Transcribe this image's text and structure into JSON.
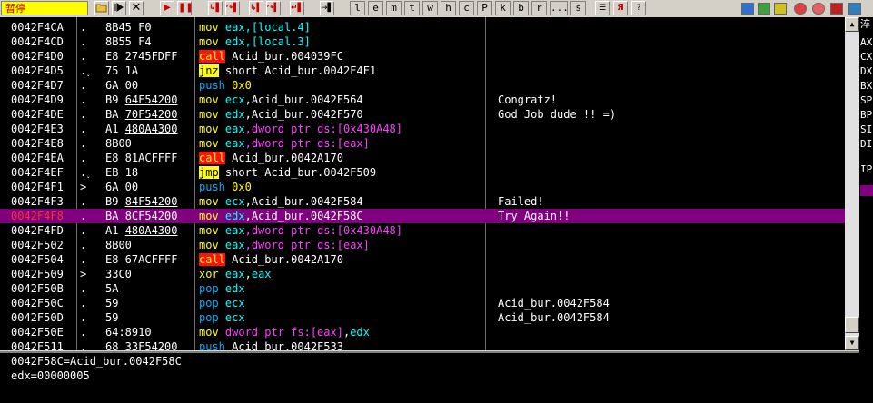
{
  "toolbar": {
    "status": "暂停",
    "letters": [
      "l",
      "e",
      "m",
      "t",
      "w",
      "h",
      "c",
      "P",
      "k",
      "b",
      "r",
      "...",
      "s"
    ]
  },
  "rows": [
    {
      "addr": "0042F4CA",
      "mark": ".",
      "hex": "8B45 F0",
      "hex_u": "",
      "dis": [
        {
          "t": "mov",
          "c": "mn-mov"
        },
        {
          "t": " "
        },
        {
          "t": "eax",
          "c": "reg"
        },
        {
          "t": ",[local.4]",
          "c": "reg"
        }
      ],
      "comment": ""
    },
    {
      "addr": "0042F4CD",
      "mark": ".",
      "hex": "8B55 F4",
      "hex_u": "",
      "dis": [
        {
          "t": "mov",
          "c": "mn-mov"
        },
        {
          "t": " "
        },
        {
          "t": "edx",
          "c": "reg"
        },
        {
          "t": ",[local.3]",
          "c": "reg"
        }
      ],
      "comment": ""
    },
    {
      "addr": "0042F4D0",
      "mark": ".",
      "hex": "E8 2745FDFF",
      "hex_u": "",
      "dis": [
        {
          "t": "call",
          "c": "mn-call"
        },
        {
          "t": " Acid_bur.004039FC",
          "c": "plain"
        }
      ],
      "comment": ""
    },
    {
      "addr": "0042F4D5",
      "mark": ".˯",
      "hex": "75 1A",
      "hex_u": "",
      "dis": [
        {
          "t": "jnz",
          "c": "mn-jmp"
        },
        {
          "t": " short Acid_bur.0042F4F1",
          "c": "plain"
        }
      ],
      "comment": ""
    },
    {
      "addr": "0042F4D7",
      "mark": ".",
      "hex": "6A 00",
      "hex_u": "",
      "dis": [
        {
          "t": "push",
          "c": "mn-push"
        },
        {
          "t": " 0x0",
          "c": "hexnum"
        }
      ],
      "comment": ""
    },
    {
      "addr": "0042F4D9",
      "mark": ".",
      "hex": "B9 ",
      "hex_u": "64F54200",
      "dis": [
        {
          "t": "mov",
          "c": "mn-mov"
        },
        {
          "t": " "
        },
        {
          "t": "ecx",
          "c": "reg"
        },
        {
          "t": ",Acid_bur.0042F564",
          "c": "plain"
        }
      ],
      "comment": "Congratz!"
    },
    {
      "addr": "0042F4DE",
      "mark": ".",
      "hex": "BA ",
      "hex_u": "70F54200",
      "dis": [
        {
          "t": "mov",
          "c": "mn-mov"
        },
        {
          "t": " "
        },
        {
          "t": "edx",
          "c": "reg"
        },
        {
          "t": ",Acid_bur.0042F570",
          "c": "plain"
        }
      ],
      "comment": "God Job dude !! =)"
    },
    {
      "addr": "0042F4E3",
      "mark": ".",
      "hex": "A1 ",
      "hex_u": "480A4300",
      "dis": [
        {
          "t": "mov",
          "c": "mn-mov"
        },
        {
          "t": " "
        },
        {
          "t": "eax",
          "c": "reg"
        },
        {
          "t": ",dword ptr ds:[0x430A48]",
          "c": "mem"
        }
      ],
      "comment": ""
    },
    {
      "addr": "0042F4E8",
      "mark": ".",
      "hex": "8B00",
      "hex_u": "",
      "dis": [
        {
          "t": "mov",
          "c": "mn-mov"
        },
        {
          "t": " "
        },
        {
          "t": "eax",
          "c": "reg"
        },
        {
          "t": ",dword ptr ds:[eax]",
          "c": "mem"
        }
      ],
      "comment": ""
    },
    {
      "addr": "0042F4EA",
      "mark": ".",
      "hex": "E8 81ACFFFF",
      "hex_u": "",
      "dis": [
        {
          "t": "call",
          "c": "mn-call"
        },
        {
          "t": " Acid_bur.0042A170",
          "c": "plain"
        }
      ],
      "comment": ""
    },
    {
      "addr": "0042F4EF",
      "mark": ".˯",
      "hex": "EB 18",
      "hex_u": "",
      "dis": [
        {
          "t": "jmp",
          "c": "mn-jmp"
        },
        {
          "t": " short Acid_bur.0042F509",
          "c": "plain"
        }
      ],
      "comment": ""
    },
    {
      "addr": "0042F4F1",
      "mark": ">",
      "hex": "6A 00",
      "hex_u": "",
      "dis": [
        {
          "t": "push",
          "c": "mn-push"
        },
        {
          "t": " 0x0",
          "c": "hexnum"
        }
      ],
      "comment": ""
    },
    {
      "addr": "0042F4F3",
      "mark": ".",
      "hex": "B9 ",
      "hex_u": "84F54200",
      "dis": [
        {
          "t": "mov",
          "c": "mn-mov"
        },
        {
          "t": " "
        },
        {
          "t": "ecx",
          "c": "reg"
        },
        {
          "t": ",Acid_bur.0042F584",
          "c": "plain"
        }
      ],
      "comment": "Failed!"
    },
    {
      "addr": "0042F4F8",
      "mark": ".",
      "hex": "BA ",
      "hex_u": "8CF54200",
      "dis": [
        {
          "t": "mov",
          "c": "mn-mov"
        },
        {
          "t": " "
        },
        {
          "t": "edx",
          "c": "reg"
        },
        {
          "t": ",Acid_bur.0042F58C",
          "c": "plain"
        }
      ],
      "comment": "Try Again!!",
      "selected": true
    },
    {
      "addr": "0042F4FD",
      "mark": ".",
      "hex": "A1 ",
      "hex_u": "480A4300",
      "dis": [
        {
          "t": "mov",
          "c": "mn-mov"
        },
        {
          "t": " "
        },
        {
          "t": "eax",
          "c": "reg"
        },
        {
          "t": ",dword ptr ds:[0x430A48]",
          "c": "mem"
        }
      ],
      "comment": ""
    },
    {
      "addr": "0042F502",
      "mark": ".",
      "hex": "8B00",
      "hex_u": "",
      "dis": [
        {
          "t": "mov",
          "c": "mn-mov"
        },
        {
          "t": " "
        },
        {
          "t": "eax",
          "c": "reg"
        },
        {
          "t": ",dword ptr ds:[eax]",
          "c": "mem"
        }
      ],
      "comment": ""
    },
    {
      "addr": "0042F504",
      "mark": ".",
      "hex": "E8 67ACFFFF",
      "hex_u": "",
      "dis": [
        {
          "t": "call",
          "c": "mn-call"
        },
        {
          "t": " Acid_bur.0042A170",
          "c": "plain"
        }
      ],
      "comment": ""
    },
    {
      "addr": "0042F509",
      "mark": ">",
      "hex": "33C0",
      "hex_u": "",
      "dis": [
        {
          "t": "xor",
          "c": "mn-xor"
        },
        {
          "t": " "
        },
        {
          "t": "eax",
          "c": "reg"
        },
        {
          "t": ",",
          "c": "plain"
        },
        {
          "t": "eax",
          "c": "reg"
        }
      ],
      "comment": ""
    },
    {
      "addr": "0042F50B",
      "mark": ".",
      "hex": "5A",
      "hex_u": "",
      "dis": [
        {
          "t": "pop",
          "c": "mn-push"
        },
        {
          "t": " "
        },
        {
          "t": "edx",
          "c": "reg"
        }
      ],
      "comment": ""
    },
    {
      "addr": "0042F50C",
      "mark": ".",
      "hex": "59",
      "hex_u": "",
      "dis": [
        {
          "t": "pop",
          "c": "mn-push"
        },
        {
          "t": " "
        },
        {
          "t": "ecx",
          "c": "reg"
        }
      ],
      "comment": "Acid_bur.0042F584"
    },
    {
      "addr": "0042F50D",
      "mark": ".",
      "hex": "59",
      "hex_u": "",
      "dis": [
        {
          "t": "pop",
          "c": "mn-push"
        },
        {
          "t": " "
        },
        {
          "t": "ecx",
          "c": "reg"
        }
      ],
      "comment": "Acid_bur.0042F584"
    },
    {
      "addr": "0042F50E",
      "mark": ".",
      "hex": "64:8910",
      "hex_u": "",
      "dis": [
        {
          "t": "mov",
          "c": "mn-mov"
        },
        {
          "t": " dword ptr fs:[eax]",
          "c": "mem"
        },
        {
          "t": ",",
          "c": "plain"
        },
        {
          "t": "edx",
          "c": "reg"
        }
      ],
      "comment": ""
    },
    {
      "addr": "0042F511",
      "mark": ".",
      "hex": "68 33F54200",
      "hex_u": "",
      "dis": [
        {
          "t": "push",
          "c": "mn-push"
        },
        {
          "t": " Acid_bur.0042F533",
          "c": "plain"
        }
      ],
      "comment": ""
    }
  ],
  "info": {
    "line1": "0042F58C=Acid_bur.0042F58C",
    "line2": "edx=00000005"
  },
  "registers": [
    "淬",
    "AX",
    "CX",
    "DX",
    "BX",
    "SP",
    "BP",
    "SI",
    "DI",
    "",
    "IP"
  ],
  "colors": {
    "selected_row": "#800080",
    "status_bg": "#ffff00",
    "call_bg": "#ff1010"
  }
}
